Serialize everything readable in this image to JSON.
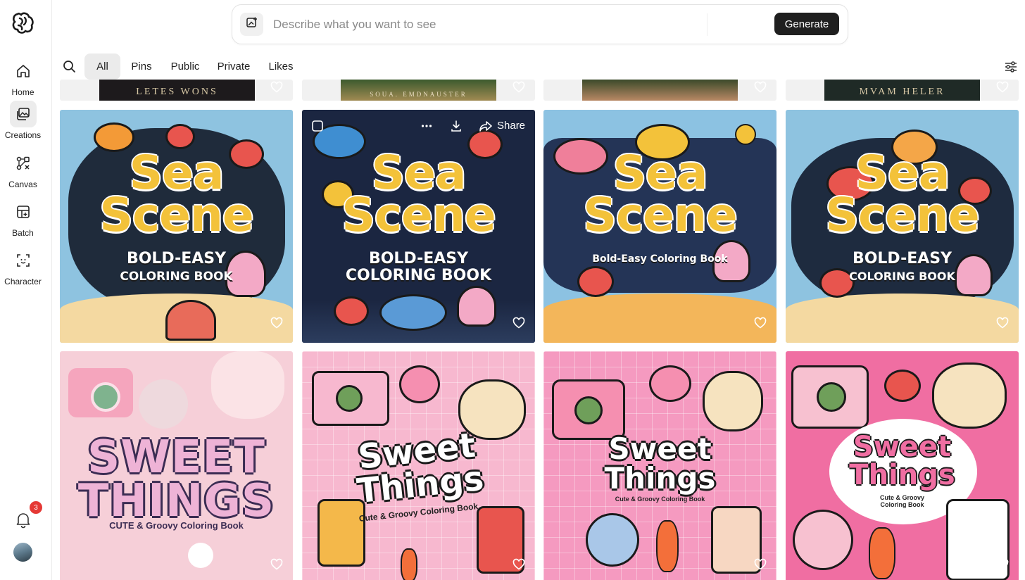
{
  "sidebar": {
    "logo_icon": "brain-logo-icon",
    "items": [
      {
        "label": "Home",
        "icon": "home-icon"
      },
      {
        "label": "Creations",
        "icon": "image-gallery-icon",
        "active": true
      },
      {
        "label": "Canvas",
        "icon": "canvas-nodes-icon"
      },
      {
        "label": "Batch",
        "icon": "batch-icon"
      },
      {
        "label": "Character",
        "icon": "character-scan-icon"
      }
    ],
    "notifications": {
      "icon": "bell-icon",
      "count": "3"
    },
    "avatar_icon": "user-avatar"
  },
  "prompt_bar": {
    "placeholder": "Describe what you want to see",
    "value": "",
    "image_button_icon": "image-upload-icon",
    "generate_label": "Generate"
  },
  "filters": {
    "search_icon": "search-icon",
    "tabs": [
      {
        "label": "All",
        "active": true
      },
      {
        "label": "Pins"
      },
      {
        "label": "Public"
      },
      {
        "label": "Private"
      },
      {
        "label": "Likes"
      }
    ],
    "settings_icon": "sliders-icon"
  },
  "gallery": {
    "partial_row": [
      {
        "text": "LETES WONS"
      },
      {
        "text": "SOUA. EMDNAUSTER"
      },
      {
        "text": ""
      },
      {
        "text": "MVAM HELER"
      }
    ],
    "sea_row": [
      {
        "title_line1": "Sea",
        "title_line2": "Scene",
        "subtitle_line1": "BOLD-EASY",
        "subtitle_line2": "COLORING BOOK",
        "bg": "#1f2b3b"
      },
      {
        "title_line1": "Sea",
        "title_line2": "Scene",
        "subtitle_line1": "BOLD-EASY",
        "subtitle_line2": "COLORING BOOK",
        "bg": "#1b2641",
        "hovered": true
      },
      {
        "title_line1": "Sea",
        "title_line2": "Scene",
        "subtitle_line1": "Bold-Easy Coloring Book",
        "subtitle_line2": "",
        "bg": "#243456"
      },
      {
        "title_line1": "Sea",
        "title_line2": "Scene",
        "subtitle_line1": "BOLD-EASY",
        "subtitle_line2": "COLORING BOOK",
        "bg": "#1e2b3f"
      }
    ],
    "hover_overlay": {
      "checkbox_icon": "select-checkbox-icon",
      "more_icon": "more-dots-icon",
      "download_icon": "download-icon",
      "share_icon": "share-arrow-icon",
      "share_label": "Share"
    },
    "sweet_row": [
      {
        "title_line1": "SWEET",
        "title_line2": "THINGS",
        "subtitle": "CUTE & Groovy Coloring Book",
        "style": "photo"
      },
      {
        "title_line1": "Sweet",
        "title_line2": "Things",
        "subtitle": "Cute & Groovy Coloring Book",
        "style": "flat"
      },
      {
        "title_line1": "Sweet",
        "title_line2": "Things",
        "subtitle": "Cute & Groovy Coloring Book",
        "style": "flat"
      },
      {
        "title_line1": "Sweet",
        "title_line2": "Things",
        "subtitle": "Cute & Groovy\nColoring Book",
        "style": "flat"
      }
    ],
    "heart_icon": "heart-outline-icon"
  },
  "colors": {
    "generate_bg": "#1f1f1f",
    "badge": "#e53935",
    "sea_title": "#f3c23a",
    "sweet_pink": "#f7b8cf"
  }
}
